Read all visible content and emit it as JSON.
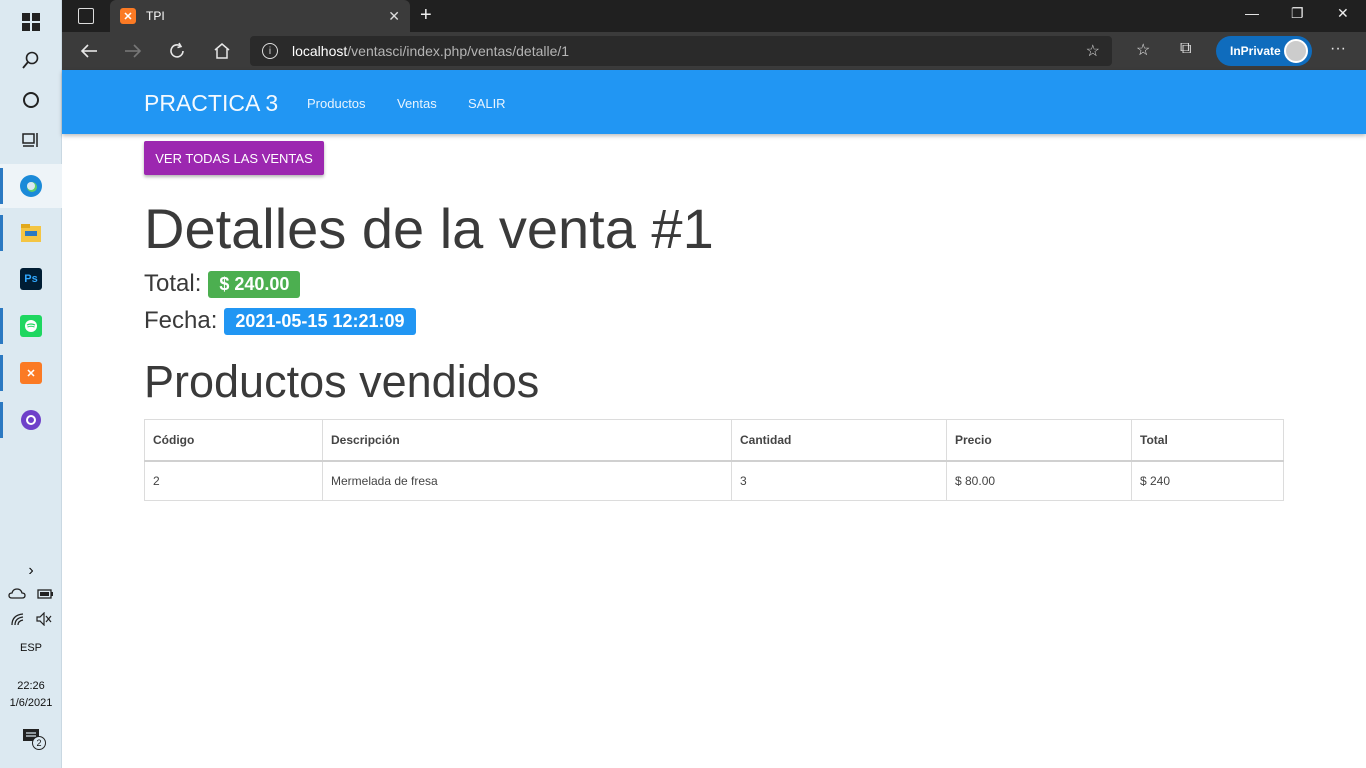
{
  "browser": {
    "tab_title": "TPI",
    "tab_close": "✕",
    "new_tab": "+",
    "url_host": "localhost",
    "url_path": "/ventasci/index.php/ventas/detalle/1",
    "inprivate_label": "InPrivate"
  },
  "navbar": {
    "brand": "PRACTICA 3",
    "links": [
      "Productos",
      "Ventas",
      "SALIR"
    ]
  },
  "content": {
    "ver_button": "VER TODAS LAS VENTAS",
    "title": "Detalles de la venta #1",
    "total_label": "Total:",
    "total_value": "$ 240.00",
    "fecha_label": "Fecha:",
    "fecha_value": "2021-05-15 12:21:09",
    "subtitle": "Productos vendidos"
  },
  "table": {
    "headers": [
      "Código",
      "Descripción",
      "Cantidad",
      "Precio",
      "Total"
    ],
    "rows": [
      [
        "2",
        "Mermelada de fresa",
        "3",
        "$ 80.00",
        "$ 240"
      ]
    ]
  },
  "taskbar": {
    "language": "ESP",
    "time": "22:26",
    "date": "1/6/2021",
    "notification_count": "2"
  },
  "colors": {
    "navbar": "#2196f3",
    "ver_button": "#9c27b0",
    "badge_total": "#4caf50",
    "badge_fecha": "#2196f3"
  }
}
